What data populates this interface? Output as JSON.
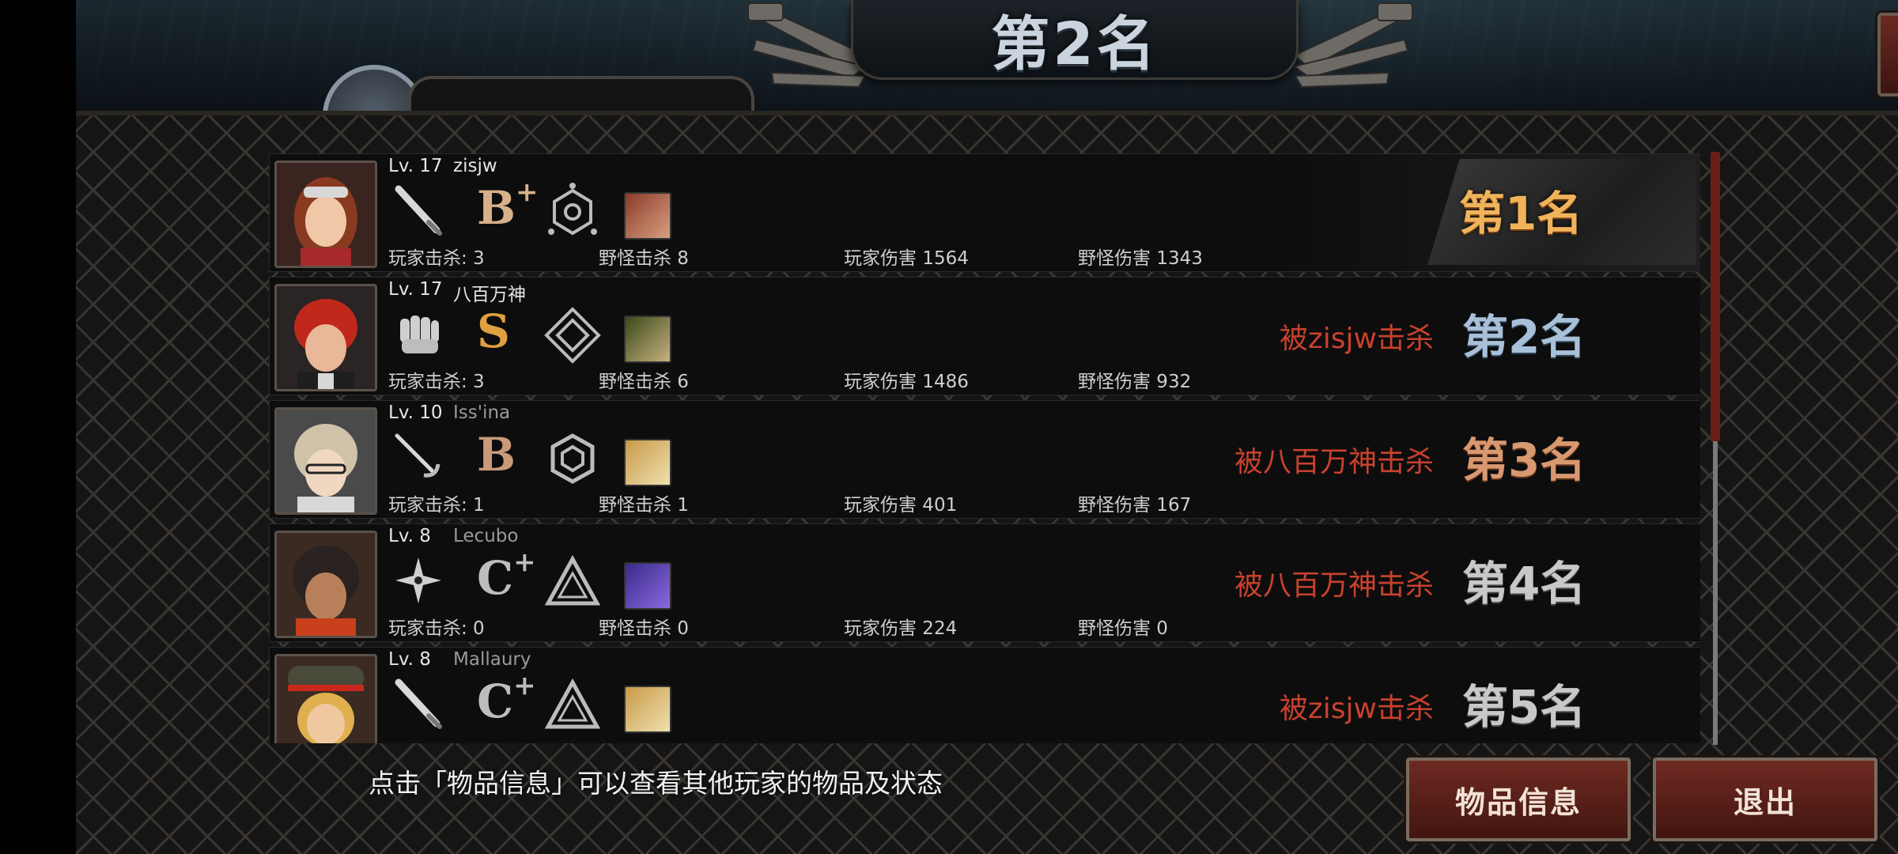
{
  "header": {
    "title": "第2名",
    "emblem_value": "",
    "emblem_tab_label": ""
  },
  "players": [
    {
      "level": "Lv. 17",
      "name": "zisjw",
      "name_dim": false,
      "grade": "B",
      "grade_plus": "+",
      "stats": {
        "player_kills": "玩家击杀: 3",
        "monster_kills": "野怪击杀 8",
        "player_damage": "玩家伤害 1564",
        "monster_damage": "野怪伤害 1343"
      },
      "killed_by": "",
      "rank": "第1名",
      "rank_style": "gold",
      "hair_color": "#8b3a22",
      "weapon_icon": "bat-icon",
      "skill_icon": "hexagon-emblem-icon",
      "item_color": "#8a3a2a"
    },
    {
      "level": "Lv. 17",
      "name": "八百万神",
      "name_dim": false,
      "grade": "S",
      "grade_plus": "",
      "stats": {
        "player_kills": "玩家击杀: 3",
        "monster_kills": "野怪击杀 6",
        "player_damage": "玩家伤害 1486",
        "monster_damage": "野怪伤害 932"
      },
      "killed_by": "被zisjw击杀",
      "rank": "第2名",
      "rank_style": "blue",
      "hair_color": "#c0281c",
      "weapon_icon": "fist-icon",
      "skill_icon": "diamond-emblem-icon",
      "item_color": "#5a6a2a"
    },
    {
      "level": "Lv. 10",
      "name": "Iss'ina",
      "name_dim": true,
      "grade": "B",
      "grade_plus": "",
      "stats": {
        "player_kills": "玩家击杀: 1",
        "monster_kills": "野怪击杀 1",
        "player_damage": "玩家伤害 401",
        "monster_damage": "野怪伤害 167"
      },
      "killed_by": "被八百万神击杀",
      "rank": "第3名",
      "rank_style": "bronze",
      "hair_color": "#cfc2a8",
      "weapon_icon": "rapier-icon",
      "skill_icon": "cube-emblem-icon",
      "item_color": "#c89a48"
    },
    {
      "level": "Lv. 8",
      "name": "Lecubo",
      "name_dim": true,
      "grade": "C",
      "grade_plus": "+",
      "stats": {
        "player_kills": "玩家击杀: 0",
        "monster_kills": "野怪击杀 0",
        "player_damage": "玩家伤害 224",
        "monster_damage": "野怪伤害 0"
      },
      "killed_by": "被八百万神击杀",
      "rank": "第4名",
      "rank_style": "grey",
      "hair_color": "#2a2220",
      "weapon_icon": "shuriken-icon",
      "skill_icon": "triangle-emblem-icon",
      "item_color": "#5a3aa8"
    },
    {
      "level": "Lv. 8",
      "name": "Mallaury",
      "name_dim": true,
      "grade": "C",
      "grade_plus": "+",
      "stats": {
        "player_kills": "",
        "monster_kills": "",
        "player_damage": "",
        "monster_damage": ""
      },
      "killed_by": "被zisjw击杀",
      "rank": "第5名",
      "rank_style": "grey",
      "hair_color": "#e0b050",
      "weapon_icon": "bat-icon",
      "skill_icon": "triangle-emblem-icon",
      "item_color": "#c89a48"
    }
  ],
  "footer": {
    "hint": "点击「物品信息」可以查看其他玩家的物品及状态",
    "items_button": "物品信息",
    "exit_button": "退出"
  },
  "colors": {
    "accent_red": "#c8412e",
    "gold": "#f0b35a",
    "button_red": "#6e2a22"
  }
}
